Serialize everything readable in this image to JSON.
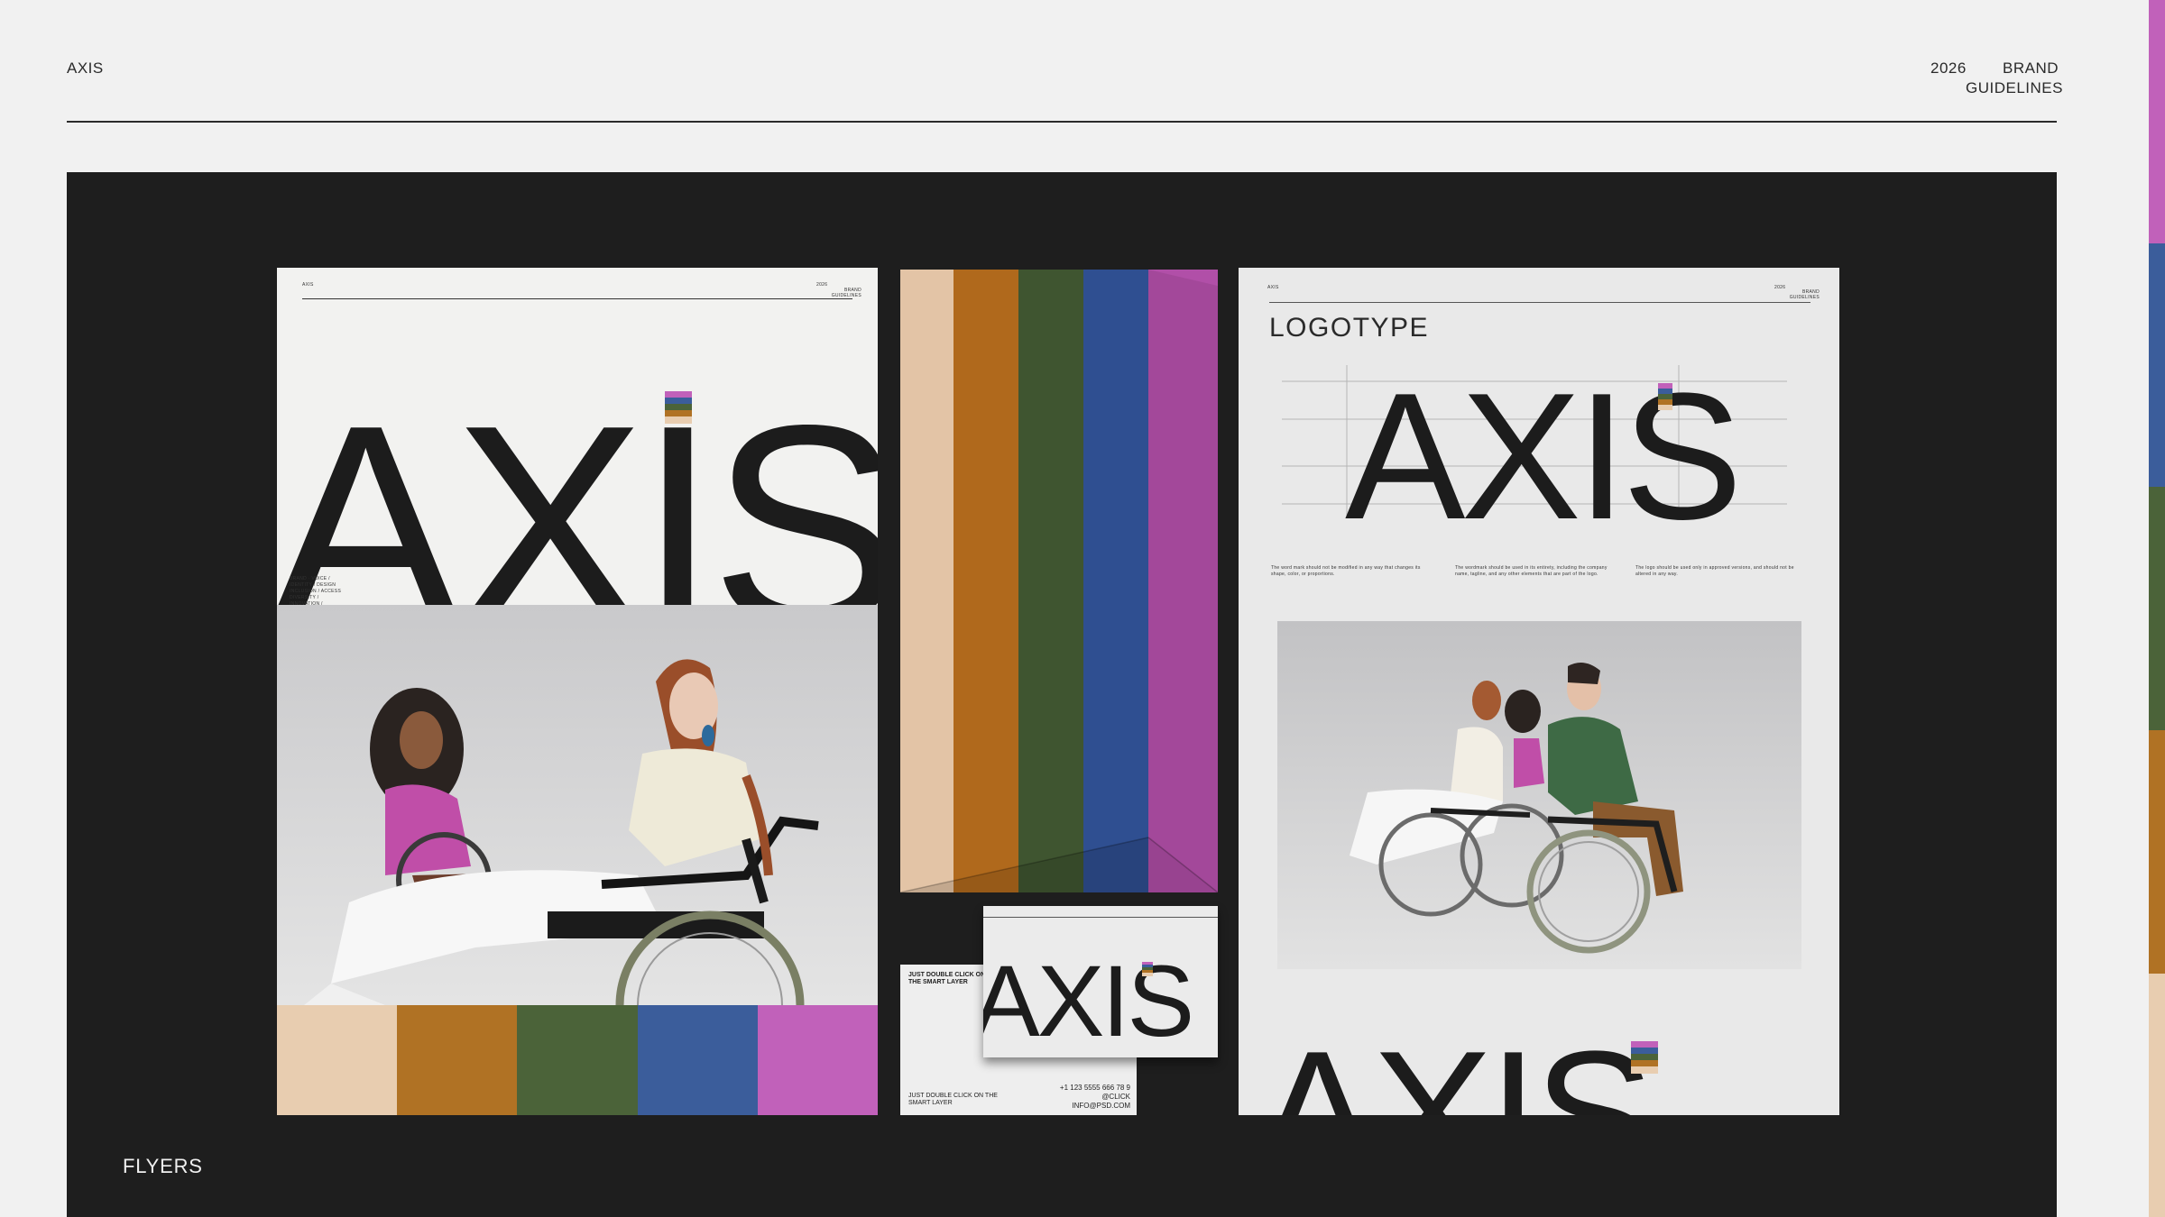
{
  "header": {
    "brand": "AXIS",
    "year": "2026",
    "guidelines_line1": "BRAND",
    "guidelines_line2": "GUIDELINES"
  },
  "colors": {
    "page_bg": "#f1f1f1",
    "panel_bg": "#1e1e1e",
    "beige": "#e8cdb0",
    "ochre": "#b07224",
    "green": "#4b6339",
    "blue": "#3b5d9b",
    "magenta": "#c161ba"
  },
  "flyer_left": {
    "mini_brand": "AXIS",
    "mini_year": "2026",
    "mini_guidelines": "BRAND GUIDELINES",
    "big_word": "AXIS",
    "side_note_title": "BRAND · VOICE /",
    "side_note_lines": [
      "IDENTITY / DESIGN",
      "INCLUSION / ACCESS",
      "DIVERSITY /",
      "INNOVATION /"
    ]
  },
  "flyer_right": {
    "mini_brand": "AXIS",
    "mini_year": "2026",
    "mini_guidelines": "BRAND GUIDELINES",
    "section_title": "LOGOTYPE",
    "logo_word": "AXIS",
    "notes": [
      "The word mark should not be modified in any way that changes its shape, color, or proportions.",
      "The wordmark should be used in its entirety, including the company name, tagline, and any other elements that are part of the logo.",
      "The logo should be used only in approved versions, and should not be altered in any way."
    ],
    "footer_word": "AXIS"
  },
  "business_card": {
    "logo_word": "AXIS",
    "front_label": "JUST DOUBLE CLICK ON THE SMART LAYER",
    "back_label": "JUST DOUBLE CLICK ON THE SMART LAYER",
    "phone": "+1 123 5555 666 78 9",
    "handle": "@CLICK",
    "email": "INFO@PSD.COM"
  },
  "section_label": "FLYERS"
}
